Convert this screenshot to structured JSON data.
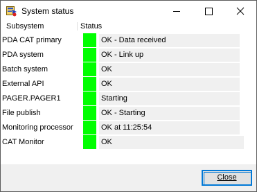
{
  "window": {
    "title": "System status"
  },
  "titlebar": {
    "icons": [
      "app-icon",
      "minimize-icon",
      "maximize-icon",
      "close-icon"
    ]
  },
  "table": {
    "headers": {
      "subsystem": "Subsystem",
      "status": "Status"
    },
    "rows": [
      {
        "name": "PDA CAT primary",
        "status": "OK - Data received",
        "indicator_color": "#00ff00"
      },
      {
        "name": "PDA system",
        "status": "OK - Link up",
        "indicator_color": "#00ff00"
      },
      {
        "name": "Batch system",
        "status": "OK",
        "indicator_color": "#00ff00"
      },
      {
        "name": "External API",
        "status": "OK",
        "indicator_color": "#00ff00"
      },
      {
        "name": "PAGER.PAGER1",
        "status": "Starting",
        "indicator_color": "#00ff00"
      },
      {
        "name": "File publish",
        "status": "OK - Starting",
        "indicator_color": "#00ff00"
      },
      {
        "name": "Monitoring processor",
        "status": "OK at 11:25:54",
        "indicator_color": "#00ff00"
      },
      {
        "name": "CAT Monitor",
        "status": "OK",
        "indicator_color": "#00ff00"
      }
    ]
  },
  "footer": {
    "close_label": "Close"
  },
  "colors": {
    "status_ok": "#00ff00",
    "accent": "#0078d7"
  }
}
